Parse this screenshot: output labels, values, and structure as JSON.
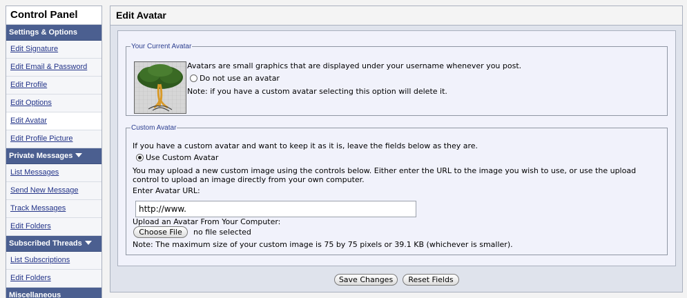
{
  "sidebar": {
    "title": "Control Panel",
    "sections": [
      {
        "label": "Settings & Options",
        "items": [
          "Edit Signature",
          "Edit Email & Password",
          "Edit Profile",
          "Edit Options",
          "Edit Avatar",
          "Edit Profile Picture"
        ]
      },
      {
        "label": "Private Messages",
        "items": [
          "List Messages",
          "Send New Message",
          "Track Messages",
          "Edit Folders"
        ]
      },
      {
        "label": "Subscribed Threads",
        "items": [
          "List Subscriptions",
          "Edit Folders"
        ]
      },
      {
        "label": "Miscellaneous",
        "items": []
      }
    ],
    "active_item": "Edit Avatar"
  },
  "main": {
    "title": "Edit Avatar",
    "current": {
      "legend": "Your Current Avatar",
      "description": "Avatars are small graphics that are displayed under your username whenever you post.",
      "no_avatar_label": "Do not use an avatar",
      "note": "Note: if you have a custom avatar selecting this option will delete it."
    },
    "custom": {
      "legend": "Custom Avatar",
      "intro": "If you have a custom avatar and want to keep it as it is, leave the fields below as they are.",
      "use_custom_label": "Use Custom Avatar",
      "upload_instructions_1": "You may upload a new custom image using the controls below. Either enter the URL to the image you wish to use, or use the upload",
      "upload_instructions_2": "control to upload an image directly from your own computer.",
      "url_label": "Enter Avatar URL:",
      "url_value": "http://www.",
      "upload_label": "Upload an Avatar From Your Computer:",
      "choose_file_label": "Choose File",
      "file_status": "no file selected",
      "size_note": "Note: The maximum size of your custom image is 75 by 75 pixels or 39.1 KB (whichever is smaller)."
    },
    "buttons": {
      "save": "Save Changes",
      "reset": "Reset Fields"
    }
  },
  "colors": {
    "section_bg": "#4b5f90",
    "link": "#223388",
    "panel_bg": "#f1f2fb",
    "legend": "#2a3d8f"
  }
}
